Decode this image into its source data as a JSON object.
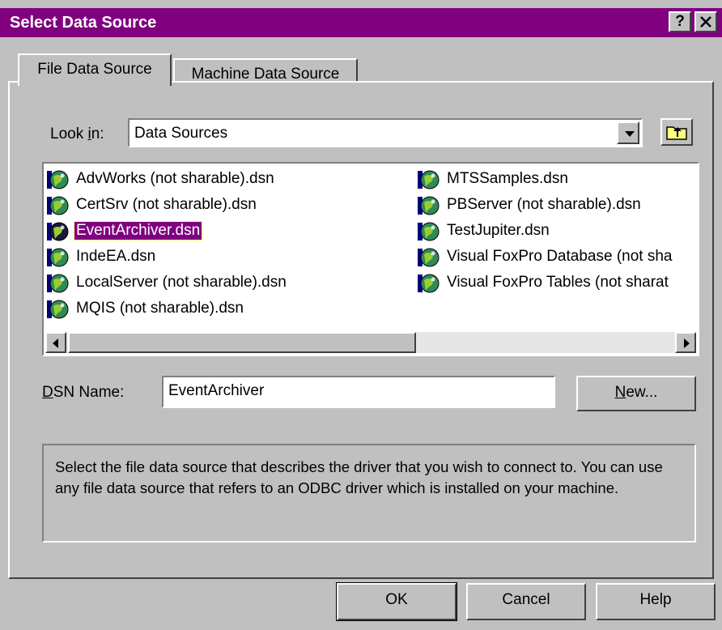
{
  "window": {
    "title": "Select Data Source",
    "help_button": "?",
    "close_button": "✕",
    "title_color": "#800080"
  },
  "tabs": [
    {
      "label": "File Data Source",
      "active": true
    },
    {
      "label": "Machine Data Source",
      "active": false
    }
  ],
  "look_in": {
    "label": "Look in:",
    "value": "Data Sources",
    "up_folder_icon": "up-one-level-folder-icon"
  },
  "file_list": {
    "selected": "EventArchiver.dsn",
    "items_col1": [
      "AdvWorks (not sharable).dsn",
      "CertSrv (not sharable).dsn",
      "EventArchiver.dsn",
      "IndeEA.dsn",
      "LocalServer (not sharable).dsn",
      "MQIS (not sharable).dsn"
    ],
    "items_col2": [
      "MTSSamples.dsn",
      "PBServer (not sharable).dsn",
      "TestJupiter.dsn",
      "Visual FoxPro Database (not sha",
      "Visual FoxPro Tables (not sharat"
    ],
    "item_icon": "dsn-globe-icon"
  },
  "dsn_name": {
    "label": "DSN Name:",
    "value": "EventArchiver",
    "new_button": "New..."
  },
  "description": "Select the file data source that describes the driver that you wish to connect to. You can use any file data source that refers to an ODBC driver which is installed on your machine.",
  "buttons": {
    "ok": "OK",
    "cancel": "Cancel",
    "help": "Help"
  }
}
